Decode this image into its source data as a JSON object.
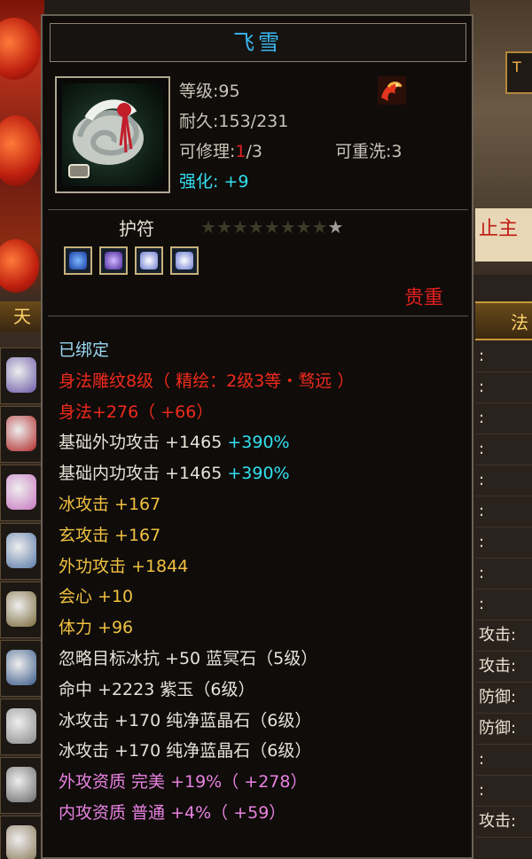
{
  "item": {
    "name": "飞雪",
    "level": "等级:95",
    "durability": {
      "label": "耐久:",
      "value": "153/231"
    },
    "repair": {
      "label": "可修理:",
      "current": "1",
      "max": "/3"
    },
    "rewash": "可重洗:3",
    "enhance": {
      "label": "强化:",
      "value": "+9"
    },
    "type": "护符",
    "stars_total": 9,
    "stars_lit": 1,
    "rarity": "贵重"
  },
  "properties": [
    {
      "text": "已绑定",
      "color": "white"
    },
    {
      "text": "身法雕纹8级（ 精绘：2级3等・骛远 ）",
      "color": "red"
    },
    {
      "text": "身法+276（ +66）",
      "color": "red"
    },
    {
      "text": "基础外功攻击  +1465 ",
      "extra": "+390%",
      "color": "white"
    },
    {
      "text": "基础内功攻击  +1465 ",
      "extra": "+390%",
      "color": "white"
    },
    {
      "text": "冰攻击  +167",
      "color": "gold"
    },
    {
      "text": "玄攻击  +167",
      "color": "gold"
    },
    {
      "text": "外功攻击  +1844",
      "color": "gold"
    },
    {
      "text": "会心  +10",
      "color": "gold"
    },
    {
      "text": "体力  +96",
      "color": "gold"
    },
    {
      "text": "忽略目标冰抗  +50  蓝冥石（5级）",
      "color": "white"
    },
    {
      "text": "命中  +2223  紫玉（6级）",
      "color": "white"
    },
    {
      "text": "冰攻击  +170  纯净蓝晶石（6级）",
      "color": "white"
    },
    {
      "text": "冰攻击  +170  纯净蓝晶石（6级）",
      "color": "white"
    },
    {
      "text": "外攻资质    完美  +19%（ +278）",
      "color": "pink"
    },
    {
      "text": "内攻资质    普通  +4%（ +59）",
      "color": "pink"
    }
  ],
  "background": {
    "right_banner": "止主",
    "right_corner": "T",
    "right_header": "法",
    "left_label": "天",
    "right_rows": [
      ":",
      ":",
      ":",
      ":",
      ":",
      ":",
      ":",
      ":",
      ":",
      "攻击:",
      "攻击:",
      "防御:",
      "防御:",
      ":",
      ":",
      "攻击:"
    ]
  },
  "colors": {
    "title": "#3ab8f2",
    "red": "#f02a1c",
    "gold": "#f0c040",
    "pink": "#e882e0",
    "cyan": "#33e0f0"
  }
}
